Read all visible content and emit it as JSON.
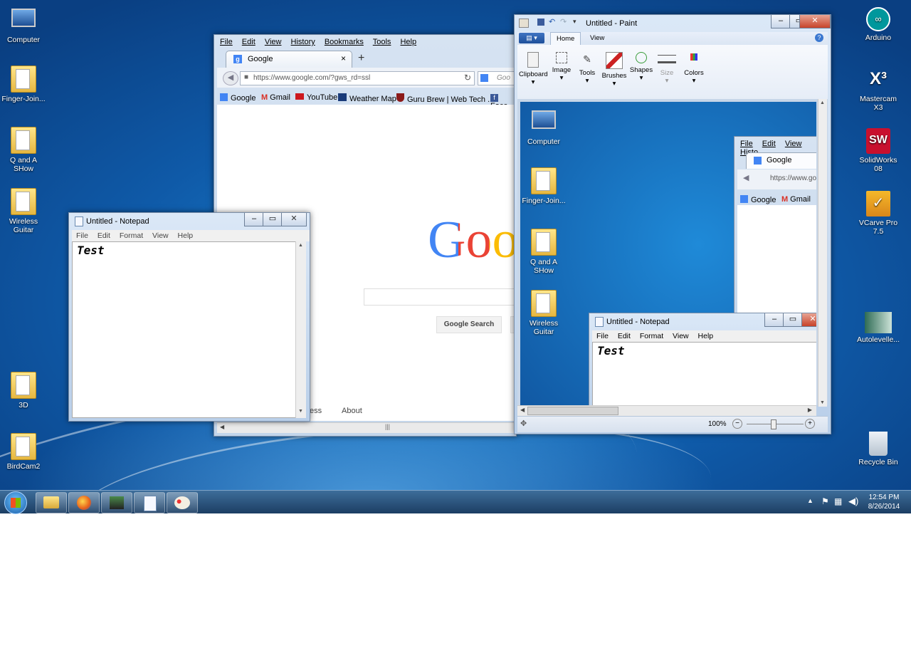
{
  "desktop_icons_left": [
    {
      "label": "Computer"
    },
    {
      "label": "Finger-Join..."
    },
    {
      "label": "Q and A SHow"
    },
    {
      "label": "Wireless Guitar"
    },
    {
      "label": "3D"
    },
    {
      "label": "BirdCam2"
    }
  ],
  "desktop_icons_right": [
    {
      "label": "Arduino"
    },
    {
      "label": "Mastercam X3"
    },
    {
      "label": "SolidWorks 08"
    },
    {
      "label": "VCarve Pro 7.5"
    },
    {
      "label": "Autolevelle..."
    },
    {
      "label": "Recycle Bin"
    }
  ],
  "firefox": {
    "menu": [
      "File",
      "Edit",
      "View",
      "History",
      "Bookmarks",
      "Tools",
      "Help"
    ],
    "tab_title": "Google",
    "new_tab": "+",
    "url": "https://www.google.com/?gws_rd=ssl",
    "search_placeholder": "Goo",
    "bookmarks": [
      "Google",
      "Gmail",
      "YouTube",
      "Weather Map",
      "Guru Brew | Web Tech ...",
      "Face"
    ],
    "logo_text": "Goo",
    "search_button": "Google Search",
    "footer_left": "ess",
    "footer_about": "About"
  },
  "notepad": {
    "title": "Untitled - Notepad",
    "menu": [
      "File",
      "Edit",
      "Format",
      "View",
      "Help"
    ],
    "text": "Test"
  },
  "paint": {
    "title": "Untitled - Paint",
    "tabs": [
      "Home",
      "View"
    ],
    "groups": [
      "Clipboard",
      "Image",
      "Tools",
      "Brushes",
      "Shapes",
      "Size",
      "Colors"
    ],
    "zoom": "100%",
    "canvas": {
      "icons": [
        {
          "label": "Computer"
        },
        {
          "label": "Finger-Join..."
        },
        {
          "label": "Q and A SHow"
        },
        {
          "label": "Wireless Guitar"
        }
      ],
      "ff_menu": [
        "File",
        "Edit",
        "View",
        "Histo"
      ],
      "ff_tab": "Google",
      "ff_url": "https://www.go",
      "ff_bookmarks": [
        "Google",
        "Gmail"
      ],
      "np_title": "Untitled - Notepad",
      "np_menu": [
        "File",
        "Edit",
        "Format",
        "View",
        "Help"
      ],
      "np_text": "Test"
    }
  },
  "clock": {
    "time": "12:54 PM",
    "date": "8/26/2014"
  },
  "colors": {
    "accent": "#1c3e63",
    "google_blue": "#4285f4",
    "google_red": "#ea4335",
    "google_yellow": "#fbbc05"
  }
}
